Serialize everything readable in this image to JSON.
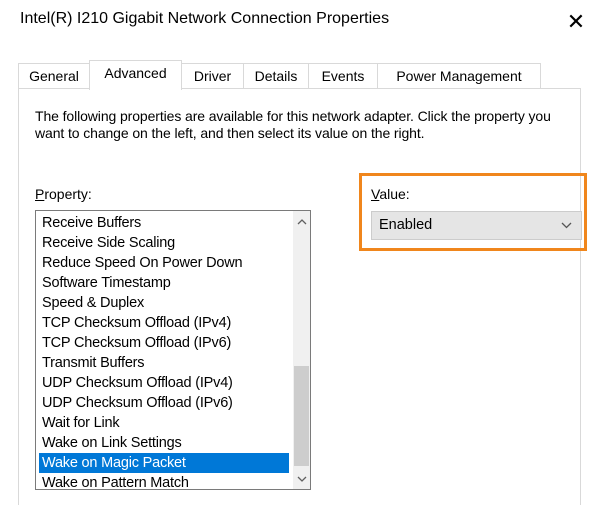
{
  "window": {
    "title": "Intel(R) I210 Gigabit Network Connection Properties",
    "close_glyph": "✕"
  },
  "tabs": [
    {
      "label": "General",
      "active": false
    },
    {
      "label": "Advanced",
      "active": true
    },
    {
      "label": "Driver",
      "active": false
    },
    {
      "label": "Details",
      "active": false
    },
    {
      "label": "Events",
      "active": false
    },
    {
      "label": "Power Management",
      "active": false
    }
  ],
  "description": "The following properties are available for this network adapter. Click the property you want to change on the left, and then select its value on the right.",
  "property": {
    "label_access_key": "P",
    "label_rest": "roperty:",
    "items": [
      "Receive Buffers",
      "Receive Side Scaling",
      "Reduce Speed On Power Down",
      "Software Timestamp",
      "Speed & Duplex",
      "TCP Checksum Offload (IPv4)",
      "TCP Checksum Offload (IPv6)",
      "Transmit Buffers",
      "UDP Checksum Offload (IPv4)",
      "UDP Checksum Offload (IPv6)",
      "Wait for Link",
      "Wake on Link Settings",
      "Wake on Magic Packet",
      "Wake on Pattern Match"
    ],
    "selected_item": "Wake on Magic Packet",
    "scroll_up_glyph": "⌃",
    "scroll_down_glyph": "⌄"
  },
  "value": {
    "label_access_key": "V",
    "label_rest": "alue:",
    "selected": "Enabled"
  },
  "colors": {
    "selection": "#0078d7",
    "highlight": "#f0861c"
  }
}
